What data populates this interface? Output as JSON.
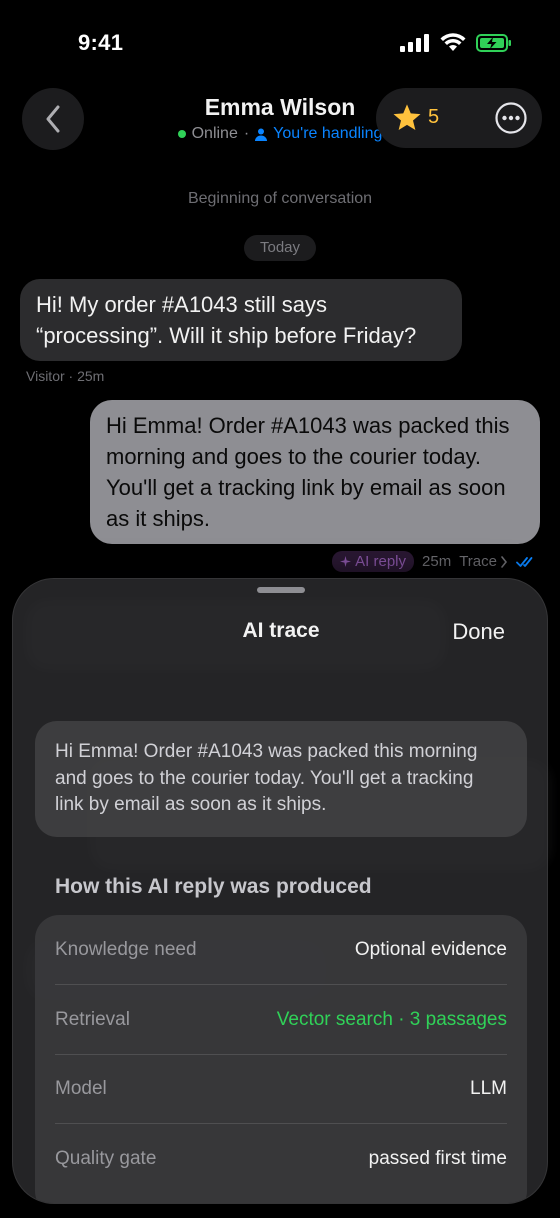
{
  "status_bar": {
    "time": "9:41"
  },
  "header": {
    "contact_name": "Emma Wilson",
    "presence": "Online",
    "separator": "·",
    "handling": "You're handling",
    "rating": "5"
  },
  "conversation": {
    "start_label": "Beginning of conversation",
    "day_label": "Today",
    "incoming": {
      "text": "Hi! My order #A1043 still says “processing”. Will it ship before Friday?",
      "meta": "Visitor · 25m"
    },
    "outgoing": {
      "text": "Hi Emma! Order #A1043 was packed this morning and goes to the courier today. You'll get a tracking link by email as soon as it ships.",
      "badge": "AI reply",
      "time": "25m",
      "trace_link": "Trace"
    }
  },
  "sheet": {
    "title": "AI trace",
    "done_label": "Done",
    "preview_text": "Hi Emma! Order #A1043 was packed this morning and goes to the courier today. You'll get a tracking link by email as soon as it ships.",
    "section_title": "How this AI reply was produced",
    "rows": [
      {
        "label": "Knowledge need",
        "value": "Optional evidence"
      },
      {
        "label": "Retrieval",
        "value": "Vector search · 3 passages"
      },
      {
        "label": "Model",
        "value": "LLM"
      },
      {
        "label": "Quality gate",
        "value": "passed first time"
      }
    ]
  },
  "colors": {
    "accent_blue": "#0a84ff",
    "online_green": "#30d158",
    "star": "#ffc23d",
    "ai_badge": "#8a56a8"
  }
}
